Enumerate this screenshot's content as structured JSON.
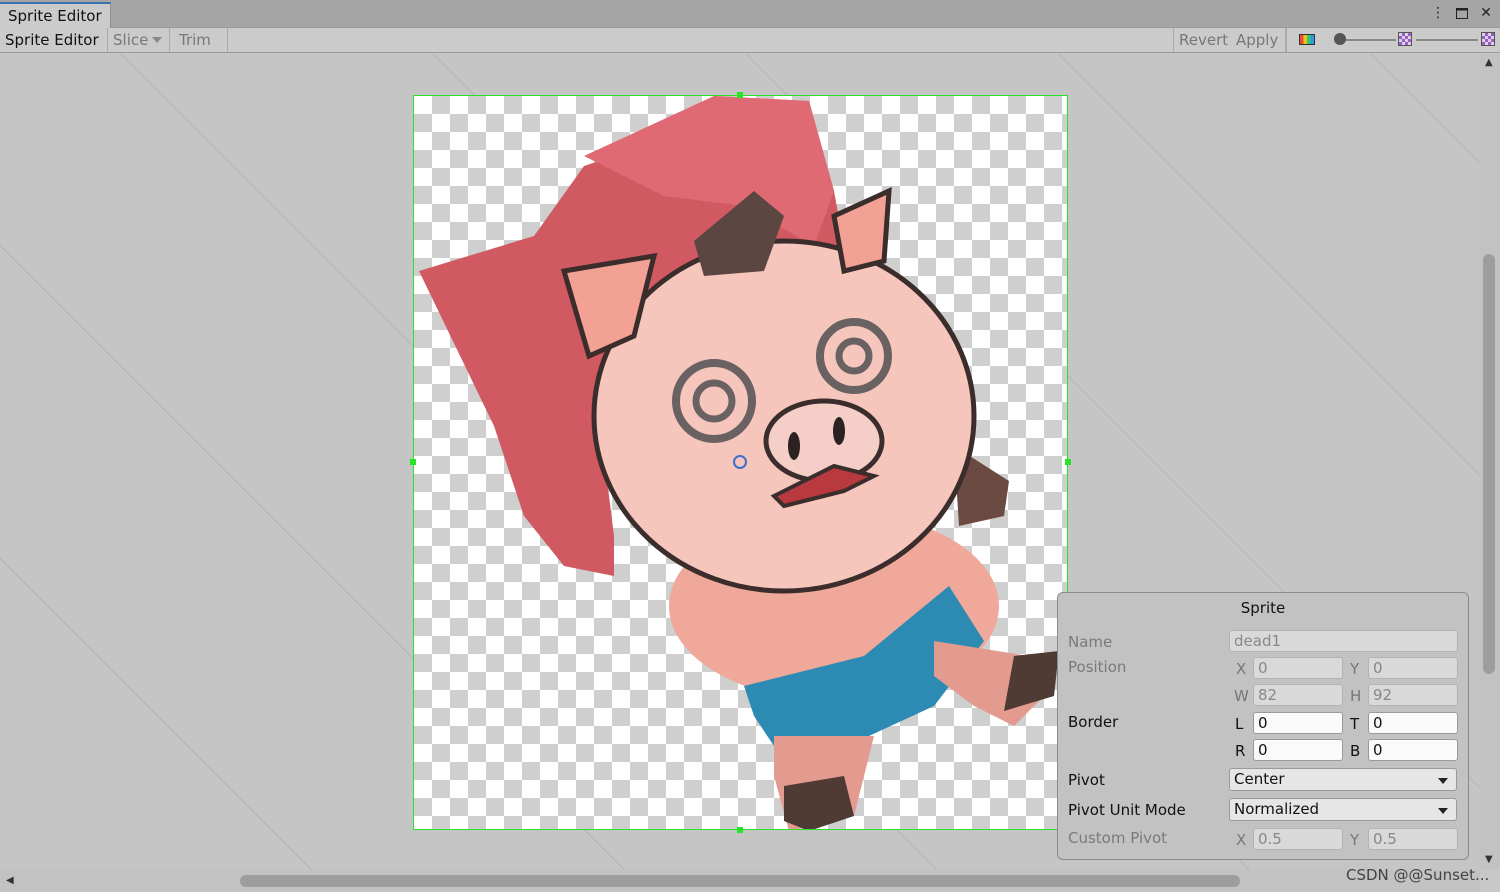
{
  "window": {
    "tab_title": "Sprite Editor"
  },
  "toolbar": {
    "mode_label": "Sprite Editor",
    "slice_label": "Slice",
    "trim_label": "Trim",
    "revert_label": "Revert",
    "apply_label": "Apply",
    "zoom_level": 0
  },
  "sprite_panel": {
    "title": "Sprite",
    "name_label": "Name",
    "name_value": "dead1",
    "position_label": "Position",
    "x_axis": "X",
    "x_value": "0",
    "y_axis": "Y",
    "y_value": "0",
    "w_axis": "W",
    "w_value": "82",
    "h_axis": "H",
    "h_value": "92",
    "border_label": "Border",
    "l_axis": "L",
    "l_value": "0",
    "t_axis": "T",
    "t_value": "0",
    "r_axis": "R",
    "r_value": "0",
    "b_axis": "B",
    "b_value": "0",
    "pivot_label": "Pivot",
    "pivot_value": "Center",
    "pivot_unit_label": "Pivot Unit Mode",
    "pivot_unit_value": "Normalized",
    "custom_pivot_label": "Custom Pivot",
    "cp_x_axis": "X",
    "cp_x_value": "0.5",
    "cp_y_axis": "Y",
    "cp_y_value": "0.5"
  },
  "watermark": "CSDN @@Sunset...",
  "colors": {
    "selection": "#29e329",
    "pivot": "#3c6fd0",
    "tab_accent": "#3a72b0"
  }
}
